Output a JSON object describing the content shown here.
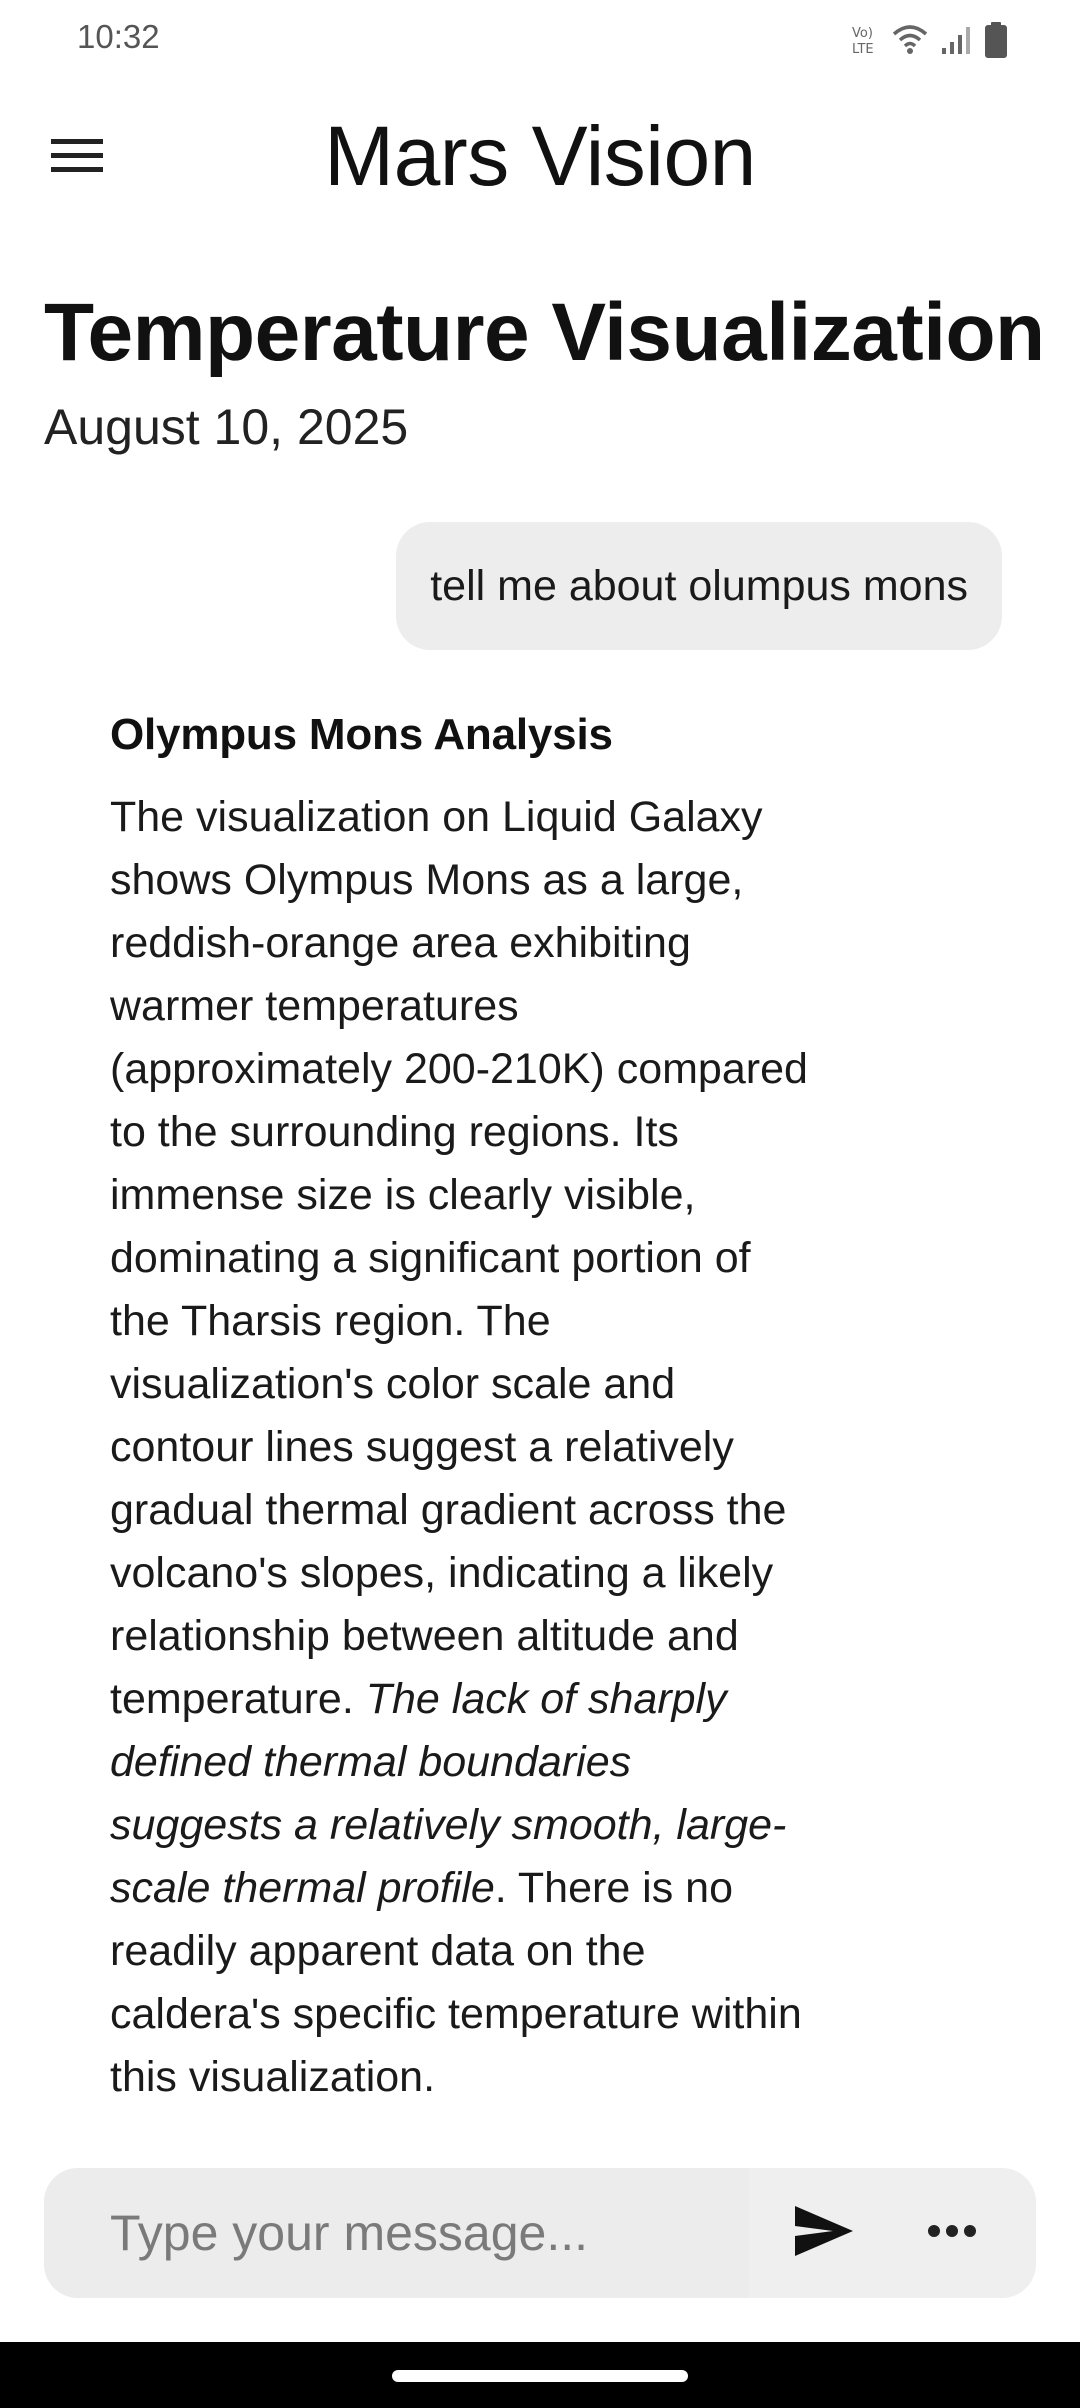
{
  "status_bar": {
    "time": "10:32",
    "icons": [
      "volte-icon",
      "wifi-icon",
      "signal-icon",
      "battery-icon"
    ]
  },
  "app_bar": {
    "title": "Mars Vision",
    "menu_icon": "hamburger-menu-icon"
  },
  "page": {
    "title": "Temperature Visualization",
    "date": "August 10, 2025"
  },
  "chat": {
    "user_message": "tell me about olumpus mons",
    "response": {
      "heading": "Olympus Mons Analysis",
      "text_before_italic": "The visualization on Liquid Galaxy shows Olympus Mons as a large, reddish-orange area exhibiting warmer temperatures (approximately 200-210K) compared to the surrounding regions.  Its immense size is clearly visible, dominating a significant portion of the Tharsis region.  The visualization's color scale and contour lines suggest a relatively gradual thermal gradient across the volcano's slopes, indicating a likely relationship between altitude and temperature. ",
      "text_italic": "The lack of sharply defined thermal boundaries suggests a relatively smooth, large-scale thermal profile",
      "text_after_italic": ".  There is no readily apparent data on the caldera's specific temperature within this visualization."
    }
  },
  "input": {
    "placeholder": "Type your message...",
    "value": "",
    "send_icon": "send-icon",
    "more_icon": "more-horizontal-icon"
  },
  "colors": {
    "background": "#ffffff",
    "bubble": "#ededed",
    "input_bar": "#efefef",
    "nav_bar": "#000000"
  }
}
